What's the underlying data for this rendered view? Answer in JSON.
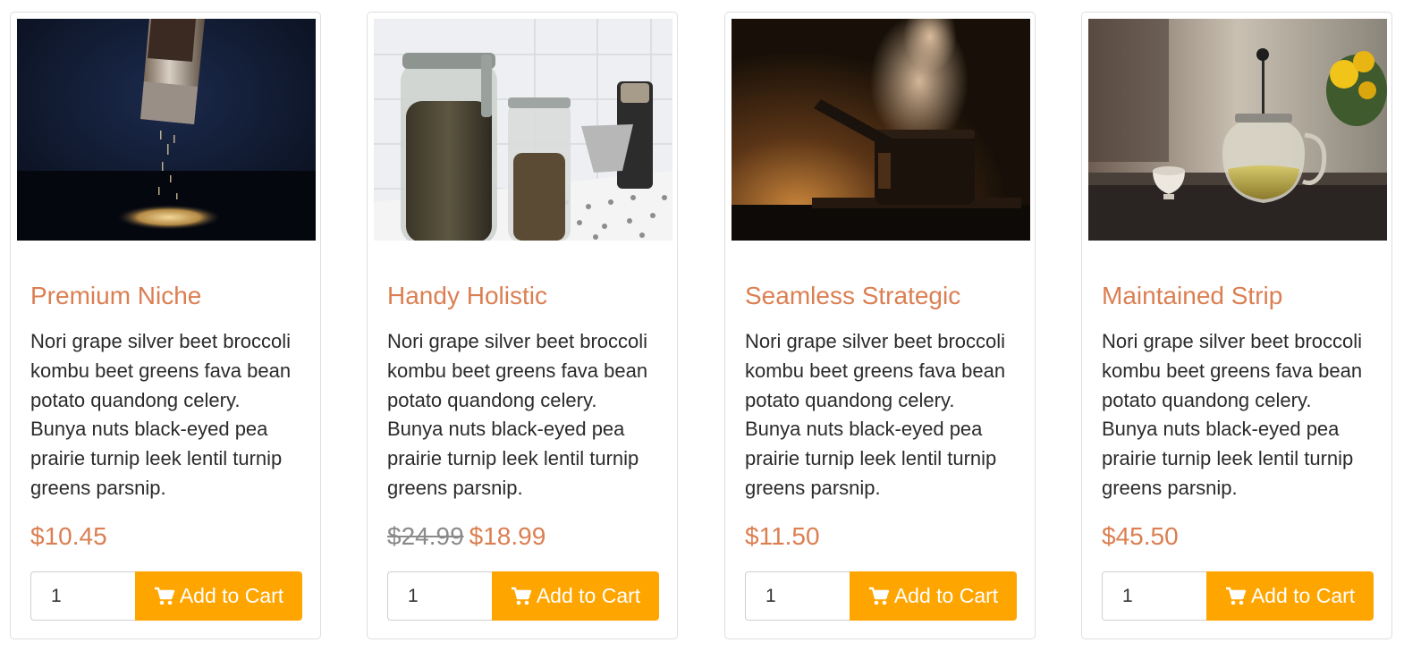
{
  "products": [
    {
      "title": "Premium Niche",
      "image_icon": "pepper-grinder-photo",
      "description": "Nori grape silver beet broccoli kombu beet greens fava bean potato quandong celery. Bunya nuts black-eyed pea prairie turnip leek lentil turnip greens parsnip.",
      "old_price": "",
      "price": "$10.45",
      "quantity": "1",
      "button_label": "Add to Cart"
    },
    {
      "title": "Handy Holistic",
      "image_icon": "coffee-jars-photo",
      "description": "Nori grape silver beet broccoli kombu beet greens fava bean potato quandong celery. Bunya nuts black-eyed pea prairie turnip leek lentil turnip greens parsnip.",
      "old_price": "$24.99",
      "price": "$18.99",
      "quantity": "1",
      "button_label": "Add to Cart"
    },
    {
      "title": "Seamless Strategic",
      "image_icon": "steaming-pot-photo",
      "description": "Nori grape silver beet broccoli kombu beet greens fava bean potato quandong celery. Bunya nuts black-eyed pea prairie turnip leek lentil turnip greens parsnip.",
      "old_price": "",
      "price": "$11.50",
      "quantity": "1",
      "button_label": "Add to Cart"
    },
    {
      "title": "Maintained Strip",
      "image_icon": "teapot-photo",
      "description": "Nori grape silver beet broccoli kombu beet greens fava bean potato quandong celery. Bunya nuts black-eyed pea prairie turnip leek lentil turnip greens parsnip.",
      "old_price": "",
      "price": "$45.50",
      "quantity": "1",
      "button_label": "Add to Cart"
    }
  ],
  "colors": {
    "accent": "#db7f52",
    "button": "#ffa500",
    "old_price": "#8a8a8a",
    "text": "#2b2b2b"
  }
}
